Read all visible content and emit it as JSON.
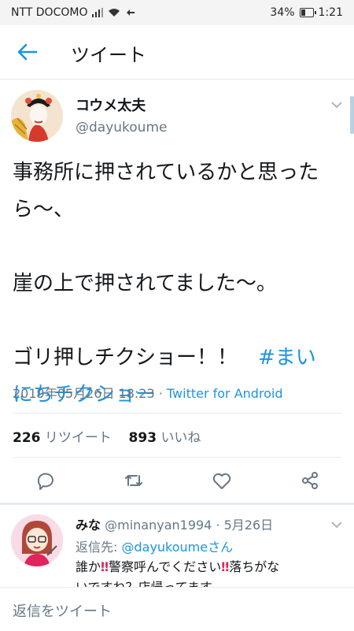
{
  "status_bar": {
    "carrier": "NTT DOCOMO",
    "battery": "34%",
    "time": "1:21"
  },
  "header": {
    "title": "ツイート",
    "back_icon": "arrow-left-icon"
  },
  "tweet": {
    "display_name": "コウメ太夫",
    "handle": "@dayukoume",
    "lines": [
      "事務所に押されているかと思った",
      "ら〜、",
      "崖の上で押されてました〜。",
      "ゴリ押しチクショー！！　"
    ],
    "hashtag_part1": "#まい",
    "hashtag_part2": "にちチクショー",
    "timestamp": "2019年05月26日 18:23 · ",
    "source": "Twitter for Android",
    "retweet_count": "226",
    "retweet_label": "リツイート",
    "like_count": "893",
    "like_label": "いいね"
  },
  "reply": {
    "name": "みな",
    "handle_date": "@minanyan1994 · 5月26日",
    "replying_prefix": "返信先: ",
    "replying_to": "@dayukoumeさん",
    "text_a": "誰か",
    "text_b": "警察呼んでください",
    "text_c": "落ちがな",
    "text_line2": "いですね？店帰ってます"
  },
  "reply_bar": {
    "placeholder": "返信をツイート"
  },
  "colors": {
    "accent": "#1b95e0",
    "secondary_text": "#657786",
    "divider": "#e6ecf0"
  }
}
